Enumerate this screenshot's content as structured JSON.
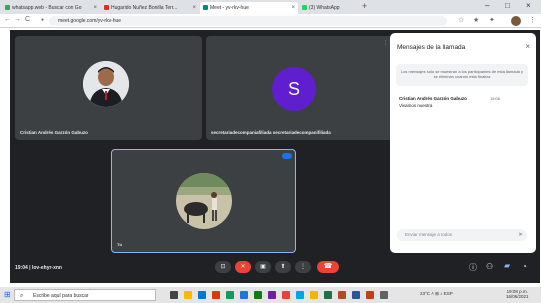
{
  "browser": {
    "tabs": [
      {
        "label": "whatsapp.web - Buscar con Go",
        "color": "#34a853"
      },
      {
        "label": "Hugarido Nuñez Bonilla Terr...",
        "color": "#d93025"
      },
      {
        "label": "Meet - yv-rkv-hue",
        "color": "#00897b",
        "active": true
      },
      {
        "label": "(3) WhatsApp",
        "color": "#25d366"
      }
    ],
    "tab_close": "×",
    "new_tab": "+",
    "address": "meet.google.com/yv-rkv-hue",
    "nav": {
      "back": "←",
      "forward": "→",
      "reload": "C",
      "home": "⌂"
    },
    "window_controls": {
      "minimize": "–",
      "maximize": "□",
      "close": "×"
    }
  },
  "meet": {
    "participants": [
      {
        "name": "Cristian Andrés Garzón Gabuzo"
      },
      {
        "name": "secretariadecompaniafiliada secretariadecompanifiliada",
        "initial": "S"
      },
      {
        "name": "Tú"
      }
    ],
    "more": "⋮",
    "chat": {
      "title": "Mensajes de la llamada",
      "close": "×",
      "notice": "Los mensajes solo se muestran a los participantes de esta llamada y se eliminan cuando esta finaliza",
      "messages": [
        {
          "sender": "Cristian Andrés Garzón Gabuzo",
          "time": "19:06",
          "text": "Vivamos nuestra"
        }
      ],
      "input_placeholder": "Enviar mensaje a todos",
      "send": "➤"
    },
    "meeting_info": "19:04  |  lov-ehyr-xnn",
    "controls": {
      "captions": "⊡",
      "mic": "🎤",
      "camera": "▣",
      "present": "⬆",
      "more": "⋮",
      "hangup": "☎"
    },
    "right_controls": {
      "info": "ⓘ",
      "people": "⚇",
      "chat": "💬",
      "activities": "◔"
    }
  },
  "taskbar": {
    "start": "⊞",
    "search_placeholder": "Escribe aquí para buscar",
    "search_icon": "⌕",
    "app_colors": [
      "#444444",
      "#ffb900",
      "#0078d7",
      "#d83b01",
      "#0f9d58",
      "#1a73e8",
      "#107c10",
      "#7719aa",
      "#ea4335",
      "#00a4ef",
      "#f4b400",
      "#217346",
      "#b7472a",
      "#2b579a",
      "#c43e1c",
      "#5f6368"
    ],
    "tray": "23°C  ˄  ⊞  ♪  ESP",
    "time": "19:08 p.m.",
    "date": "16/06/2021"
  },
  "colors": {
    "meet_bg": "#202124",
    "tile_bg": "#3c4043",
    "avatar_purple": "#5f1fcf",
    "accent": "#1a73e8",
    "hangup": "#ea4335"
  }
}
